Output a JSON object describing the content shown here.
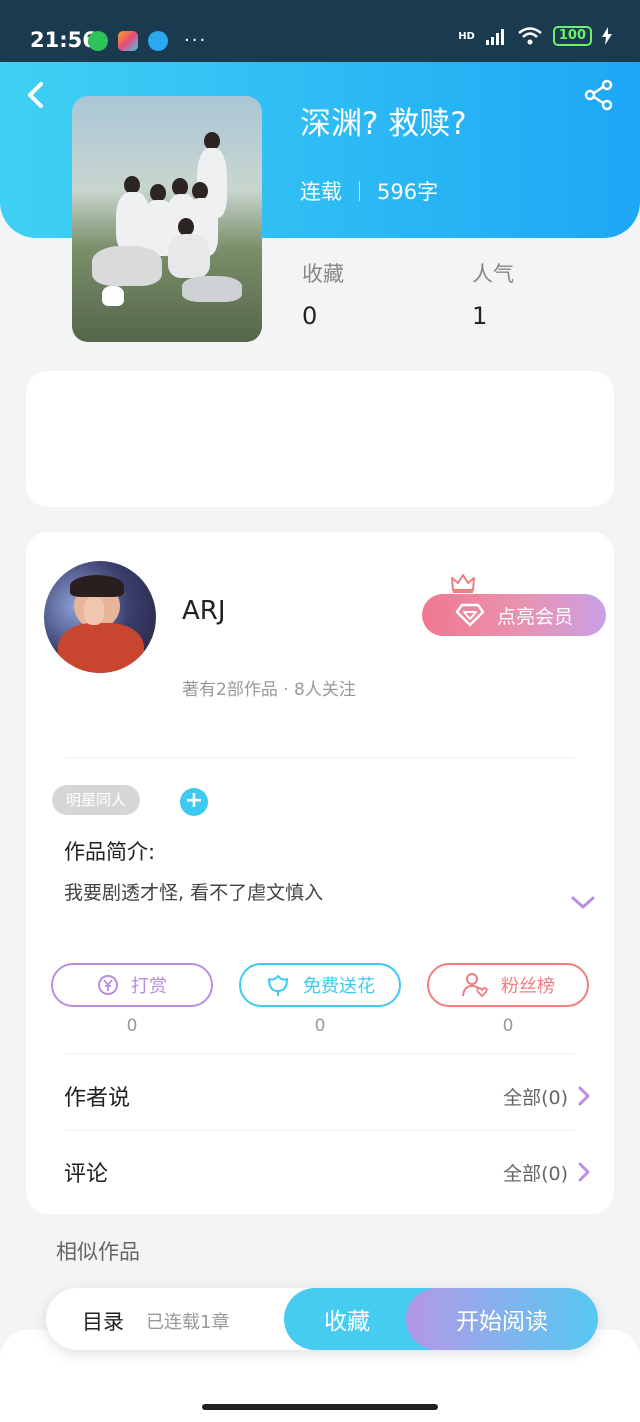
{
  "status_bar": {
    "time": "21:56",
    "more": "···",
    "hd": "HD",
    "battery": "100",
    "apps": [
      "wechat-icon",
      "photos-icon",
      "browser-icon"
    ]
  },
  "header": {
    "title": "深渊? 救赎?",
    "status": "连载",
    "word_count": "596字"
  },
  "stats": {
    "favorites_label": "收藏",
    "favorites_value": "0",
    "popularity_label": "人气",
    "popularity_value": "1"
  },
  "author": {
    "name": "ARJ",
    "subtitle": "著有2部作品 · 8人关注",
    "vip_label": "点亮会员"
  },
  "tags": [
    "明星同人"
  ],
  "tag_add": "+",
  "intro": {
    "title": "作品简介:",
    "text": "我要剧透才怪, 看不了虐文慎入"
  },
  "actions": [
    {
      "label": "打赏",
      "count": "0",
      "color": "#b98ee0"
    },
    {
      "label": "免费送花",
      "count": "0",
      "color": "#3ccaf0"
    },
    {
      "label": "粉丝榜",
      "count": "0",
      "color": "#ef7f7f"
    }
  ],
  "author_says": {
    "title": "作者说",
    "right": "全部(0)"
  },
  "comments": {
    "title": "评论",
    "right": "全部(0)"
  },
  "similar_title": "相似作品",
  "bottom_bar": {
    "toc": "目录",
    "toc_sub": "已连载1章",
    "favorite": "收藏",
    "start_reading": "开始阅读"
  },
  "colors": {
    "hero_start": "#3fd1f3",
    "hero_end": "#1da7f5",
    "accent_purple": "#b98ee0",
    "accent_cyan": "#3ccaf0"
  }
}
